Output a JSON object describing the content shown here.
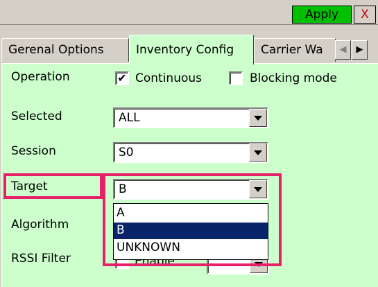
{
  "toolbar": {
    "apply_label": "Apply",
    "close_label": "X"
  },
  "tabs": [
    {
      "label": "Gerenal Options"
    },
    {
      "label": "Inventory Config"
    },
    {
      "label": "Carrier Wa"
    }
  ],
  "tab_scroll": {
    "left": "◀",
    "right": "▶"
  },
  "operation": {
    "label": "Operation",
    "continuous_label": "Continuous",
    "continuous_checked": "✔",
    "blocking_label": "Blocking mode",
    "blocking_checked": ""
  },
  "selected": {
    "label": "Selected",
    "value": "ALL"
  },
  "session": {
    "label": "Session",
    "value": "S0"
  },
  "target": {
    "label": "Target",
    "value": "B",
    "options": [
      "A",
      "B",
      "UNKNOWN"
    ],
    "selected_option": "B"
  },
  "algorithm": {
    "label": "Algorithm"
  },
  "rssi_filter": {
    "label": "RSSI Filter",
    "enable_partial": "Enable"
  },
  "colors": {
    "highlight": "#e8206a",
    "apply_bg": "#00c000",
    "panel_bg": "#ccffcc",
    "selection_bg": "#0a246a"
  }
}
